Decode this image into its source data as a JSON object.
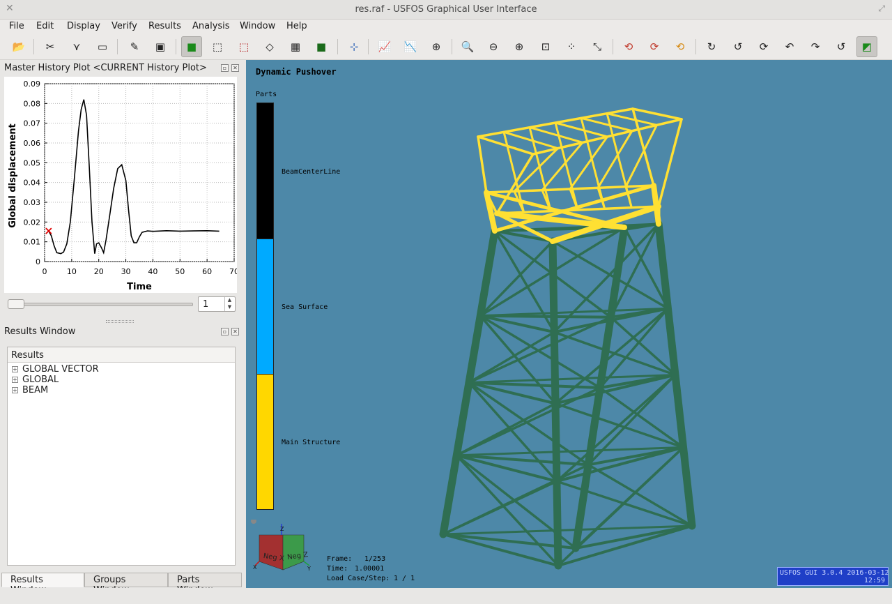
{
  "window": {
    "title": "res.raf - USFOS Graphical User Interface"
  },
  "menu": [
    "File",
    "Edit",
    "Display",
    "Verify",
    "Results",
    "Analysis",
    "Window",
    "Help"
  ],
  "toolbar_icons": [
    "open-icon",
    "cut-icon",
    "sketch-icon",
    "ruler-icon",
    "edit-icon",
    "console-icon",
    "solid-view-icon",
    "wire-cube-icon",
    "node-cube-icon",
    "cube-outline-icon",
    "cube-mesh-icon",
    "solid-cube-icon",
    "axis-icon",
    "plot-h-icon",
    "plot-d-icon",
    "target-icon",
    "zoom-icon",
    "zoom-out-icon",
    "zoom-in-icon",
    "fit-icon",
    "fit-all-icon",
    "fit-xy-icon",
    "rotate-x-icon",
    "rotate-y-icon",
    "rotate-z-icon",
    "rotate-up-icon",
    "rotate-back-icon",
    "rotate-left-icon",
    "undo-icon",
    "redo-icon",
    "reset-icon",
    "3d-view-icon"
  ],
  "history_panel": {
    "title": "Master History Plot <CURRENT History Plot>",
    "slider_value": "1",
    "chart": {
      "xlabel": "Time",
      "ylabel": "Global displacement",
      "yticks": [
        "0.09",
        "0.08",
        "0.07",
        "0.06",
        "0.05",
        "0.04",
        "0.03",
        "0.02",
        "0.01",
        "0"
      ],
      "xticks": [
        "0",
        "10",
        "20",
        "30",
        "40",
        "50",
        "60",
        "70"
      ]
    }
  },
  "chart_data": {
    "type": "line",
    "title": "",
    "xlabel": "Time",
    "ylabel": "Global displacement",
    "xlim": [
      0,
      70
    ],
    "ylim": [
      0,
      0.09
    ],
    "grid": true,
    "marker": {
      "x": 1.5,
      "y": 0.0155
    },
    "series": [
      {
        "x": [
          1.5,
          2.5,
          3.5,
          4.5,
          6,
          7,
          8.2,
          9.5,
          11,
          12.5,
          13.5,
          14.5,
          15.5,
          16.5,
          17.5,
          18.5,
          19.2,
          20,
          21,
          21.8,
          22.7,
          24,
          25.5,
          27,
          28.5,
          30,
          31,
          32,
          33,
          34,
          35,
          36,
          38,
          40,
          45,
          50,
          55,
          60,
          64.5
        ],
        "y": [
          0.0155,
          0.013,
          0.008,
          0.0045,
          0.004,
          0.0048,
          0.009,
          0.02,
          0.042,
          0.066,
          0.077,
          0.082,
          0.074,
          0.048,
          0.02,
          0.004,
          0.009,
          0.0095,
          0.007,
          0.0045,
          0.011,
          0.023,
          0.037,
          0.047,
          0.049,
          0.041,
          0.026,
          0.013,
          0.0095,
          0.0095,
          0.0125,
          0.0148,
          0.0155,
          0.0153,
          0.0156,
          0.0154,
          0.0155,
          0.0156,
          0.0154
        ]
      }
    ]
  },
  "results_panel": {
    "title": "Results Window",
    "header": "Results",
    "items": [
      "GLOBAL VECTOR",
      "GLOBAL",
      "BEAM"
    ]
  },
  "tabs": [
    "Results Window",
    "Groups Window",
    "Parts Window"
  ],
  "viewport": {
    "title": "Dynamic Pushover",
    "legend_title": "Parts",
    "legend": [
      {
        "label": "BeamCenterLine",
        "color": "#000000"
      },
      {
        "label": "Sea Surface",
        "color": "#00aaff"
      },
      {
        "label": "Main Structure",
        "color": "#ffd700"
      }
    ],
    "frame_label": "Frame:",
    "frame_value": "1/253",
    "time_label": "Time:",
    "time_value": "1.00001",
    "loadcase_label": "Load Case/Step:",
    "loadcase_value": "1 / 1",
    "cube_face_x": "Neg X",
    "cube_face_z": "Neg Z",
    "axis_z": "Z",
    "axis_x": "X",
    "axis_y": "Y",
    "badge_version": "USFOS GUI 3.0.4 2016-03-12",
    "badge_time": "12:59",
    "background": "#4d88a8",
    "deck_color": "#ffe033",
    "jacket_color": "#2f6e52"
  }
}
